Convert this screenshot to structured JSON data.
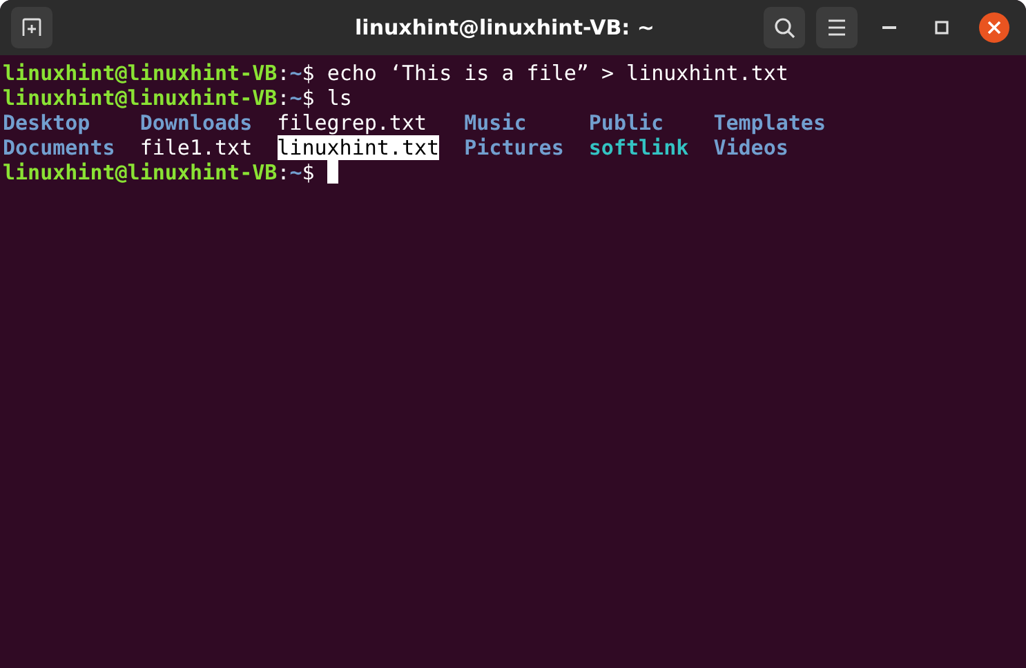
{
  "window": {
    "title": "linuxhint@linuxhint-VB: ~"
  },
  "terminal": {
    "lines": [
      {
        "kind": "command",
        "prompt": {
          "user_host": "linuxhint@linuxhint-VB",
          "separator": ":",
          "path": "~",
          "symbol": "$"
        },
        "command": "echo ‘This is a file” > linuxhint.txt"
      },
      {
        "kind": "command",
        "prompt": {
          "user_host": "linuxhint@linuxhint-VB",
          "separator": ":",
          "path": "~",
          "symbol": "$"
        },
        "command": "ls"
      },
      {
        "kind": "listing",
        "entries": [
          {
            "name": "Desktop",
            "kind": "dir",
            "highlighted": false
          },
          {
            "name": "Downloads",
            "kind": "dir",
            "highlighted": false
          },
          {
            "name": "filegrep.txt",
            "kind": "file",
            "highlighted": false
          },
          {
            "name": "Music",
            "kind": "dir",
            "highlighted": false
          },
          {
            "name": "Public",
            "kind": "dir",
            "highlighted": false
          },
          {
            "name": "Templates",
            "kind": "dir",
            "highlighted": false
          }
        ]
      },
      {
        "kind": "listing",
        "entries": [
          {
            "name": "Documents",
            "kind": "dir",
            "highlighted": false
          },
          {
            "name": "file1.txt",
            "kind": "file",
            "highlighted": false
          },
          {
            "name": "linuxhint.txt",
            "kind": "file",
            "highlighted": true
          },
          {
            "name": "Pictures",
            "kind": "dir",
            "highlighted": false
          },
          {
            "name": "softlink",
            "kind": "link",
            "highlighted": false
          },
          {
            "name": "Videos",
            "kind": "dir",
            "highlighted": false
          }
        ]
      },
      {
        "kind": "prompt",
        "prompt": {
          "user_host": "linuxhint@linuxhint-VB",
          "separator": ":",
          "path": "~",
          "symbol": "$"
        }
      }
    ]
  }
}
